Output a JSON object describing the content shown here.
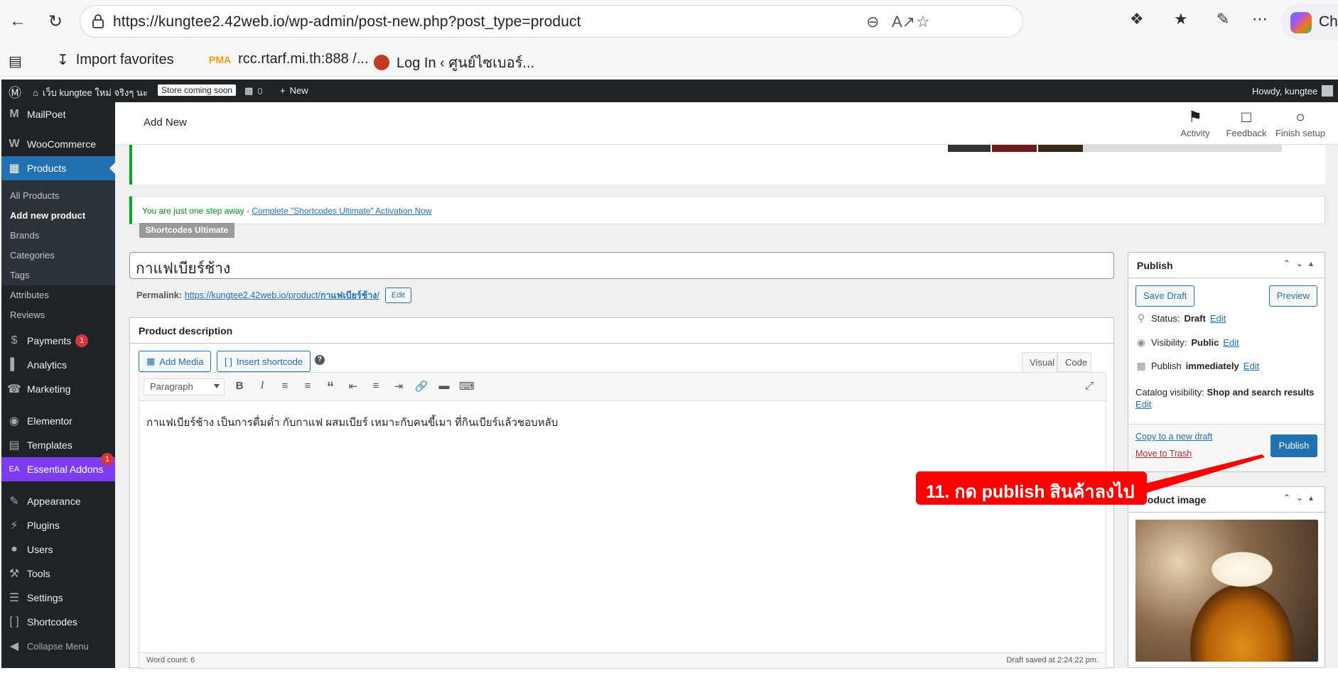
{
  "browser": {
    "url": "https://kungtee2.42web.io/wp-admin/post-new.php?post_type=product",
    "copilot_label": "Cha",
    "favorites": [
      {
        "label": "Import favorites",
        "icon": "import-icon"
      },
      {
        "label": "rcc.rtarf.mi.th:888 /...",
        "icon": "pma-icon"
      },
      {
        "label": "Log In ‹ ศูนย์ไซเบอร์...",
        "icon": "site-icon"
      }
    ]
  },
  "adminbar": {
    "site_name": "เว็บ kungtee ใหม่ จริงๆ นะ",
    "store_badge": "Store coming soon",
    "comments_count": "0",
    "new_label": "New",
    "howdy": "Howdy, kungtee"
  },
  "sidebar": {
    "items": [
      {
        "label": "MailPoet",
        "icon": "mailpoet-icon"
      },
      {
        "label": "WooCommerce",
        "icon": "woo-icon"
      },
      {
        "label": "Products",
        "icon": "products-icon"
      },
      {
        "label": "Payments",
        "icon": "payments-icon",
        "badge": "1"
      },
      {
        "label": "Analytics",
        "icon": "analytics-icon"
      },
      {
        "label": "Marketing",
        "icon": "marketing-icon"
      },
      {
        "label": "Elementor",
        "icon": "elementor-icon"
      },
      {
        "label": "Templates",
        "icon": "templates-icon"
      },
      {
        "label": "Essential Addons",
        "icon": "ea-icon",
        "badge": "1"
      },
      {
        "label": "Appearance",
        "icon": "appearance-icon"
      },
      {
        "label": "Plugins",
        "icon": "plugins-icon"
      },
      {
        "label": "Users",
        "icon": "users-icon"
      },
      {
        "label": "Tools",
        "icon": "tools-icon"
      },
      {
        "label": "Settings",
        "icon": "settings-icon"
      },
      {
        "label": "Shortcodes",
        "icon": "shortcodes-icon"
      },
      {
        "label": "Collapse Menu",
        "icon": "collapse-icon"
      }
    ],
    "submenu": [
      "All Products",
      "Add new product",
      "Brands",
      "Categories",
      "Tags",
      "Attributes",
      "Reviews"
    ]
  },
  "header": {
    "title": "Add New",
    "activity": "Activity",
    "feedback": "Feedback",
    "finish_setup": "Finish setup"
  },
  "notices": {
    "shortcodes_text": "You are just one step away - ",
    "shortcodes_link": "Complete \"Shortcodes Ultimate\" Activation Now",
    "shortcodes_tag": "Shortcodes Ultimate"
  },
  "product": {
    "title": "กาแฟเบียร์ช้าง",
    "permalink_label": "Permalink:",
    "permalink_base": "https://kungtee2.42web.io/product/",
    "permalink_slug": "กาแฟเบียร์ช้าง",
    "permalink_suffix": "/",
    "permalink_edit": "Edit"
  },
  "description": {
    "heading": "Product description",
    "add_media": "Add Media",
    "insert_shortcode": "Insert shortcode",
    "help": "?",
    "tab_visual": "Visual",
    "tab_code": "Code",
    "format": "Paragraph",
    "content": "กาแฟเบียร์ช้าง เป็นการดื่มด่ำ กับกาแฟ ผสมเบียร์ เหมาะกับคนขี้เมา ที่กินเบียร์แล้วชอบหลับ",
    "word_count": "Word count: 6",
    "draft_saved": "Draft saved at 2:24:22 pm."
  },
  "publish": {
    "heading": "Publish",
    "save_draft": "Save Draft",
    "preview": "Preview",
    "status_label": "Status:",
    "status_value": "Draft",
    "visibility_label": "Visibility:",
    "visibility_value": "Public",
    "publish_label": "Publish",
    "publish_value": "immediately",
    "catalog_label": "Catalog visibility:",
    "catalog_value": "Shop and search results",
    "edit": "Edit",
    "copy_draft": "Copy to a new draft",
    "move_trash": "Move to Trash",
    "publish_button": "Publish"
  },
  "product_image": {
    "heading": "Product image"
  },
  "annotation": {
    "text": "11. กด publish สินค้าลงไป",
    "color": "#ff0000"
  }
}
